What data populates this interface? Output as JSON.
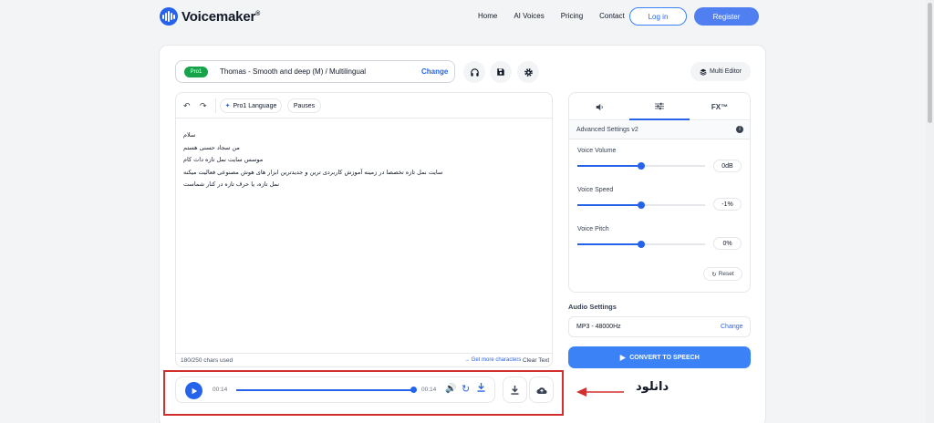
{
  "brand": {
    "name": "Voicemaker",
    "mark": "®"
  },
  "nav": {
    "home": "Home",
    "ai_voices": "AI Voices",
    "pricing": "Pricing",
    "contact": "Contact",
    "login": "Log in",
    "register": "Register"
  },
  "voice": {
    "badge": "Pro1",
    "name": "Thomas - Smooth and deep (M) / Multilingual",
    "change": "Change"
  },
  "toolbar": {
    "headphones_icon": "headphones-icon",
    "save_icon": "save-icon",
    "settings_icon": "gear-icon",
    "multi_editor": "Multi Editor"
  },
  "editor": {
    "language_pill": "Pro1 Language",
    "pauses_pill": "Pauses",
    "lines": [
      "سلام",
      "من سجاد حسنی هستم",
      "موسس سایت نمل تازه دات کام",
      "سایت نمل تازه تخصصا در زمینه آموزش کاربردی ترین و جدیدترین ابزار های هوش مصنوعی فعالیت میکنه",
      "نمل تازه، یا حرف تازه در کنار شماست"
    ],
    "chars": "180/250 chars used",
    "get_more": "Get more characters",
    "clear": "Clear Text"
  },
  "player": {
    "time_start": "00:14",
    "time_end": "00:14",
    "progress": 1.0
  },
  "settings": {
    "tab_fx": "FX™",
    "advanced": "Advanced Settings v2",
    "sliders": [
      {
        "label": "Voice Volume",
        "value": "0dB",
        "level": 0.5
      },
      {
        "label": "Voice Speed",
        "value": "-1%",
        "level": 0.5
      },
      {
        "label": "Voice Pitch",
        "value": "0%",
        "level": 0.5
      }
    ],
    "reset": "Reset"
  },
  "audio": {
    "heading": "Audio Settings",
    "format": "MP3 - 48000Hz",
    "change": "Change"
  },
  "convert": "CONVERT TO SPEECH",
  "annotation": {
    "label": "دانلود",
    "color": "#d32f2f"
  }
}
